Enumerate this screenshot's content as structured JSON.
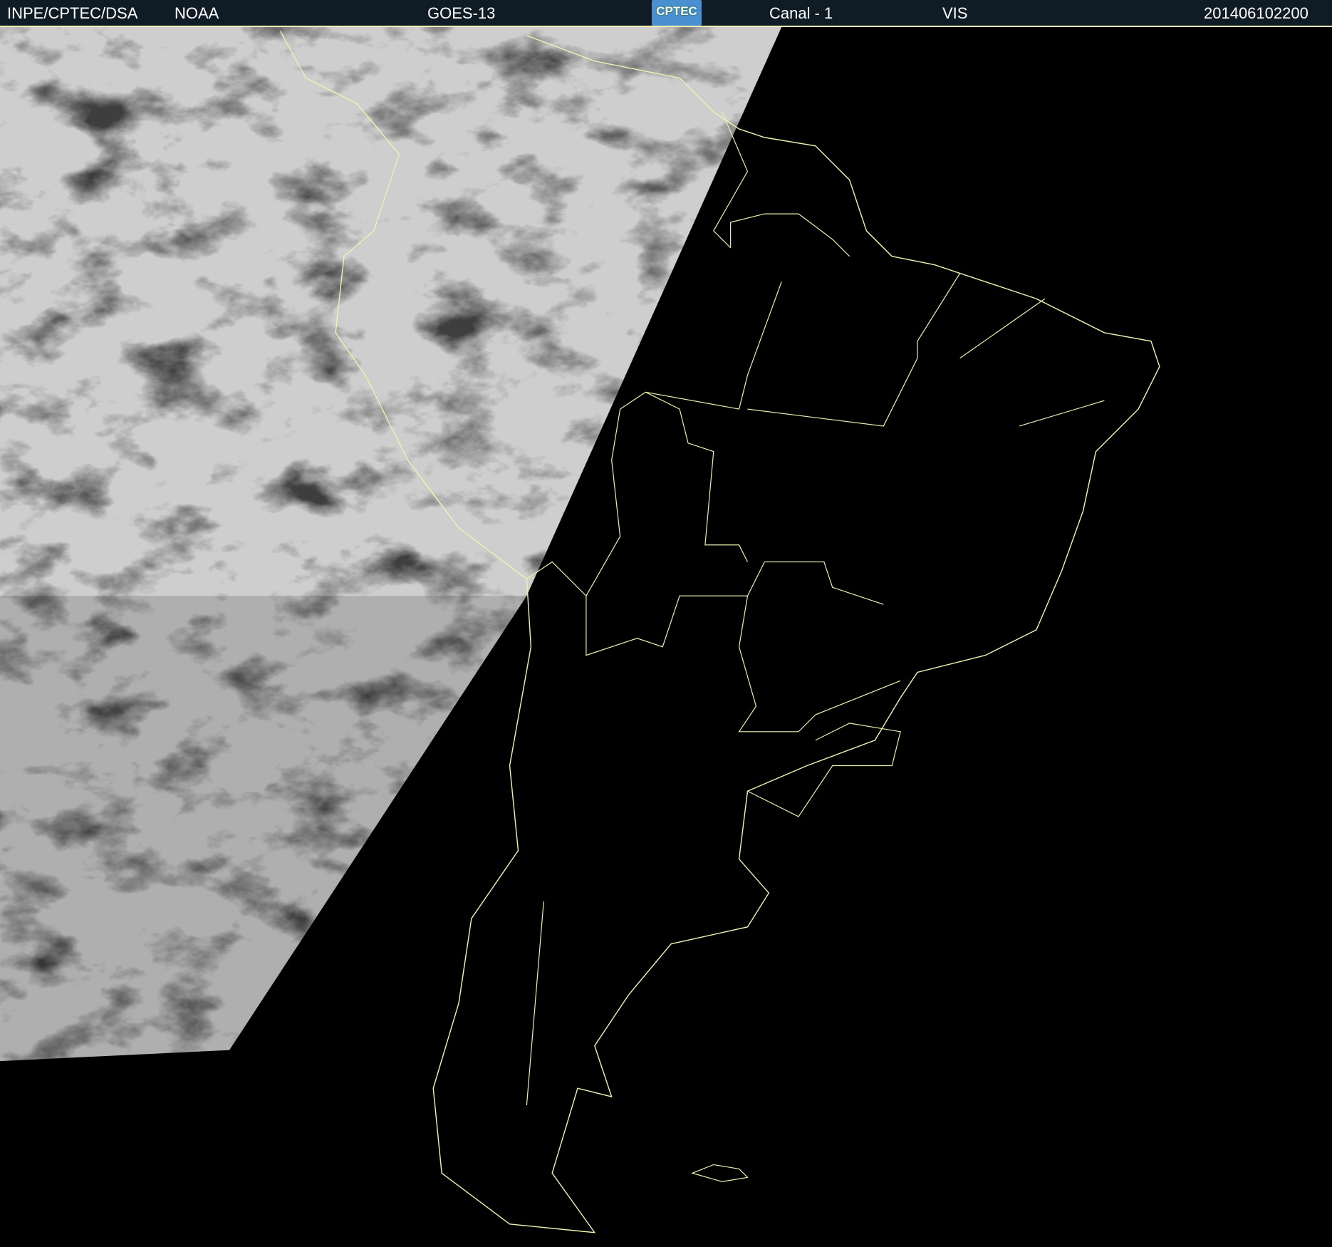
{
  "header": {
    "agency": "INPE/CPTEC/DSA",
    "source": "NOAA",
    "satellite": "GOES-13",
    "logo": "CPTEC",
    "channel": "Canal - 1",
    "band": "VIS",
    "timestamp": "201406102200"
  },
  "colors": {
    "header_bg": "#0f1c26",
    "borders": "#f0f0b0",
    "night": "#000000"
  }
}
